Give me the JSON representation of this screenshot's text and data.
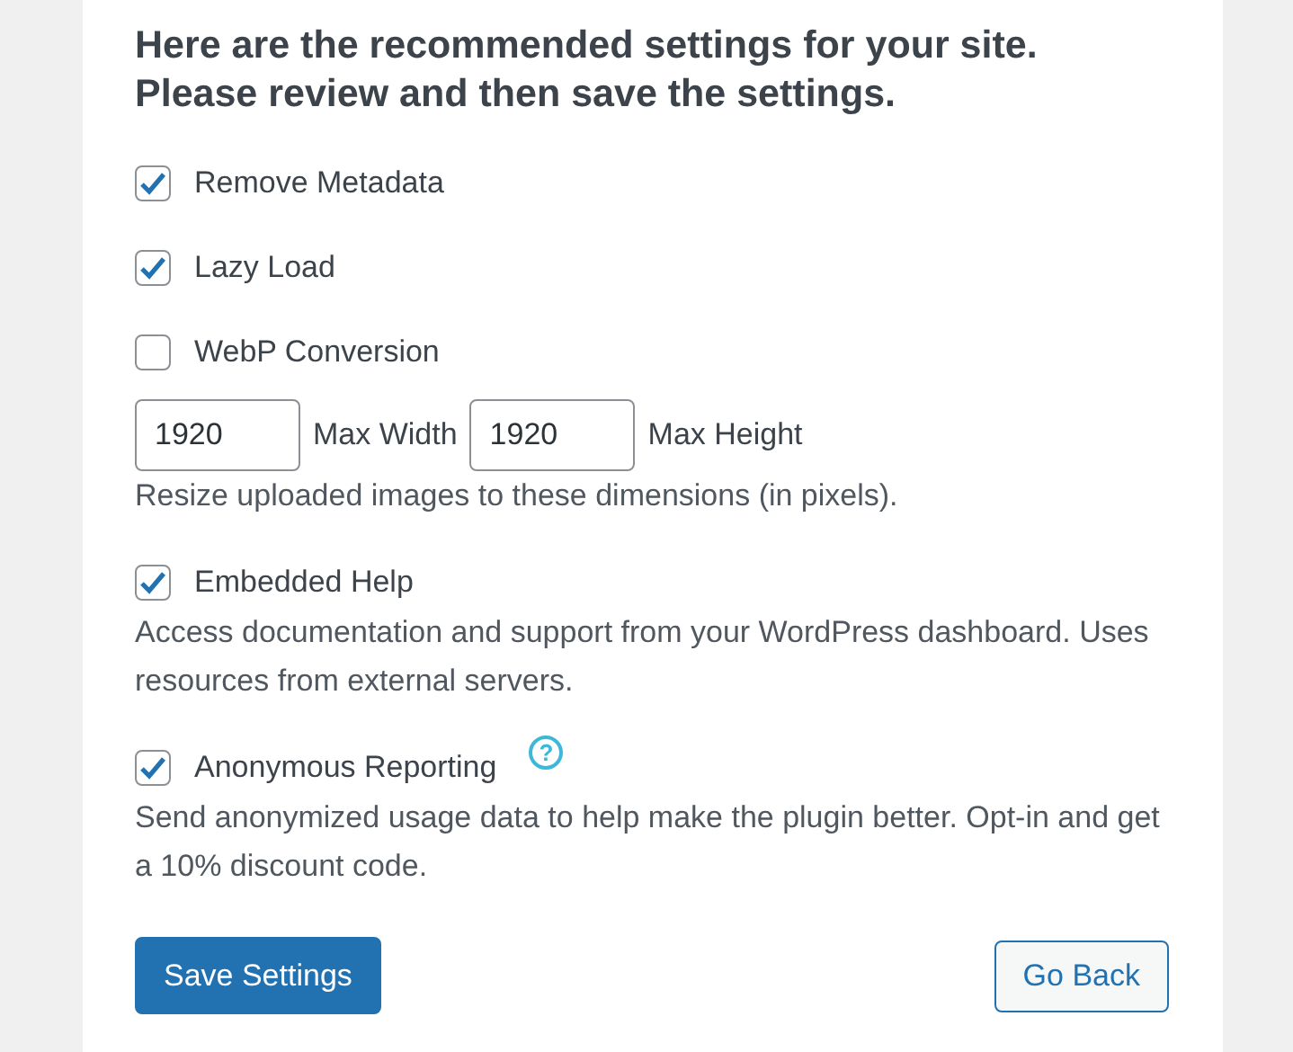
{
  "heading": "Here are the recommended settings for your site. Please review and then save the settings.",
  "settings": [
    {
      "kind": "checkbox",
      "label": "Remove Metadata",
      "checked": true
    },
    {
      "kind": "checkbox",
      "label": "Lazy Load",
      "checked": true
    },
    {
      "kind": "checkbox",
      "label": "WebP Conversion",
      "checked": false
    },
    {
      "kind": "dimensions",
      "width_value": "1920",
      "width_label": "Max Width",
      "height_value": "1920",
      "height_label": "Max Height",
      "description": "Resize uploaded images to these dimensions (in pixels)."
    },
    {
      "kind": "checkbox",
      "label": "Embedded Help",
      "checked": true,
      "description": "Access documentation and support from your WordPress dashboard. Uses resources from external servers."
    },
    {
      "kind": "checkbox",
      "label": "Anonymous Reporting",
      "checked": true,
      "help": "?",
      "description": "Send anonymized usage data to help make the plugin better. Opt-in and get a 10% discount code."
    }
  ],
  "buttons": [
    {
      "kind": "primary",
      "label": "Save Settings"
    },
    {
      "kind": "secondary",
      "label": "Go Back"
    }
  ]
}
